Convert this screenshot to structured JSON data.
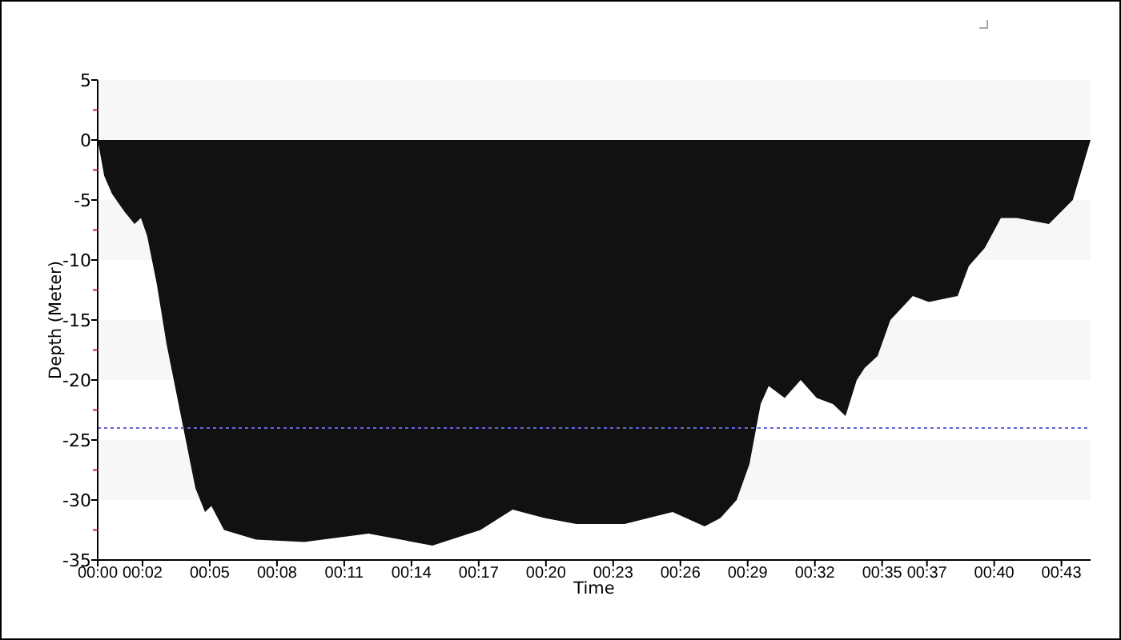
{
  "chart_data": {
    "type": "area",
    "xlabel": "Time",
    "ylabel": "Depth (Meter)",
    "x": [
      0,
      0.29,
      0.64,
      1.21,
      1.64,
      1.93,
      2.21,
      2.64,
      3.07,
      3.5,
      3.93,
      4.36,
      4.79,
      5.07,
      5.64,
      7.07,
      9.22,
      12.08,
      14.93,
      17.08,
      18.51,
      19.93,
      21.36,
      23.51,
      25.65,
      27.08,
      27.79,
      28.51,
      29.08,
      29.58,
      29.94,
      30.65,
      31.37,
      32.08,
      32.8,
      33.37,
      33.87,
      34.22,
      34.8,
      35.37,
      36.37,
      37.08,
      38.37,
      38.87,
      39.58,
      40.3,
      41.01,
      42.44,
      43.51,
      44.3
    ],
    "series": [
      {
        "color": "#111111",
        "values": [
          0,
          -3,
          -4.5,
          -6,
          -7,
          -6.5,
          -8,
          -12,
          -17,
          -21,
          -25,
          -29,
          -31,
          -30.5,
          -32.5,
          -33.3,
          -33.5,
          -32.8,
          -33.8,
          -32.5,
          -30.8,
          -31.5,
          -32,
          -32,
          -31,
          -32.2,
          -31.5,
          -30,
          -27,
          -22,
          -20.5,
          -21.5,
          -20,
          -21.5,
          -22,
          -23,
          -20,
          -19,
          -18,
          -15,
          -13,
          -13.5,
          -13,
          -10.5,
          -9,
          -6.5,
          -6.5,
          -7,
          -5,
          0
        ]
      }
    ],
    "xlim": [
      0,
      44.3
    ],
    "ylim": [
      -35,
      5
    ],
    "xticks": [
      {
        "value": 0,
        "label": "00:00"
      },
      {
        "value": 2,
        "label": "00:02"
      },
      {
        "value": 5,
        "label": "00:05"
      },
      {
        "value": 8,
        "label": "00:08"
      },
      {
        "value": 11,
        "label": "00:11"
      },
      {
        "value": 14,
        "label": "00:14"
      },
      {
        "value": 17,
        "label": "00:17"
      },
      {
        "value": 20,
        "label": "00:20"
      },
      {
        "value": 23,
        "label": "00:23"
      },
      {
        "value": 26,
        "label": "00:26"
      },
      {
        "value": 29,
        "label": "00:29"
      },
      {
        "value": 32,
        "label": "00:32"
      },
      {
        "value": 35,
        "label": "00:35"
      },
      {
        "value": 37,
        "label": "00:37"
      },
      {
        "value": 40,
        "label": "00:40"
      },
      {
        "value": 43,
        "label": "00:43"
      }
    ],
    "yticks": [
      5,
      0,
      -5,
      -10,
      -15,
      -20,
      -25,
      -30,
      -35
    ],
    "ref_lines": [
      {
        "axis": "y",
        "value": -24
      }
    ]
  }
}
